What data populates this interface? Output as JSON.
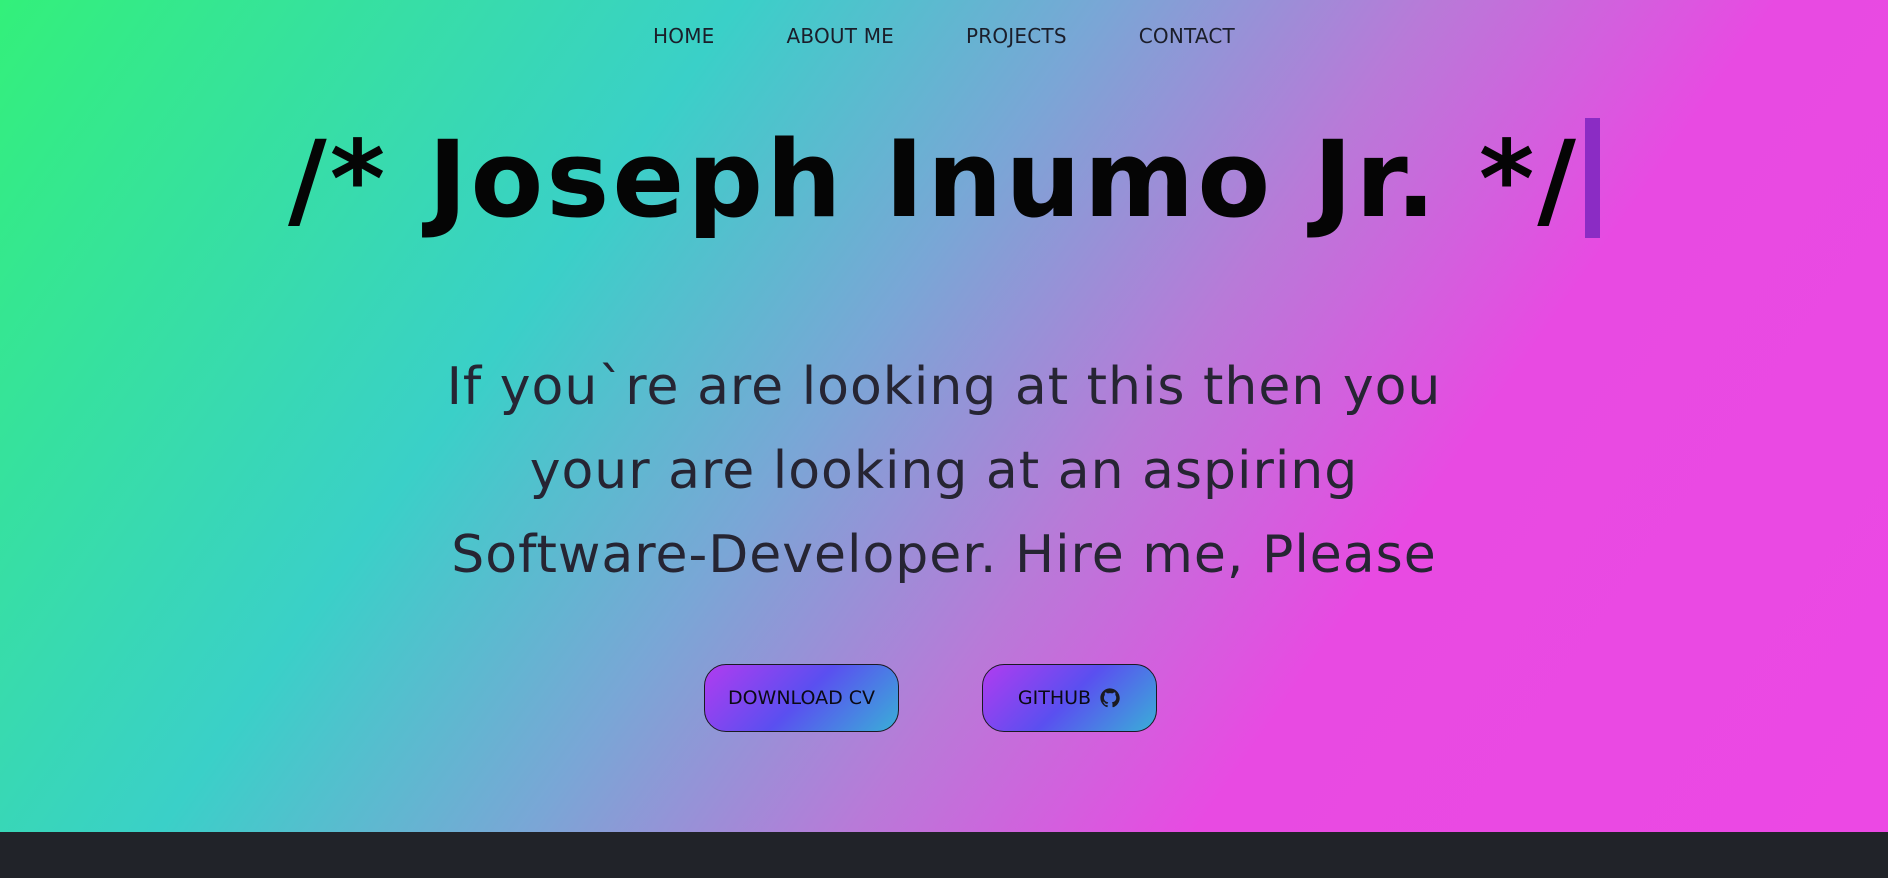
{
  "nav": {
    "items": [
      "HOME",
      "ABOUT ME",
      "PROJECTS",
      "CONTACT"
    ]
  },
  "hero": {
    "title": "/* Joseph Inumo Jr. */",
    "tagline": "If you`re are looking at this then you your are looking at an aspiring Software-Developer. Hire me, Please"
  },
  "buttons": {
    "download_cv": "DOWNLOAD CV",
    "github": "GITHUB"
  },
  "icons": {
    "github": "github-icon"
  },
  "colors": {
    "gradient_start": "#33f07a",
    "gradient_mid": "#3ad0c8",
    "gradient_end": "#ec48e4",
    "cursor": "#8b2cc4",
    "footer": "#212329"
  }
}
